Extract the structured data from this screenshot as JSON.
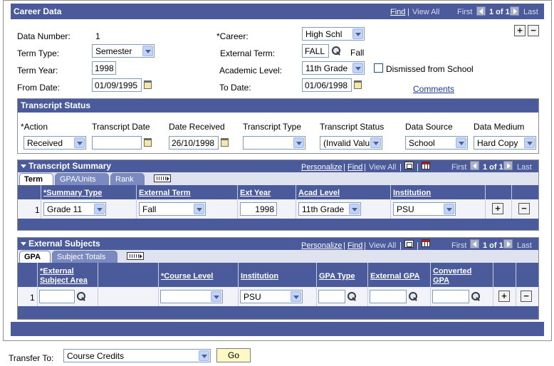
{
  "career_data": {
    "title": "Career Data",
    "nav": {
      "find": "Find",
      "sep": "|",
      "view_all": "View All",
      "first": "First",
      "count": "1 of 1",
      "last": "Last"
    },
    "fields": {
      "data_number_label": "Data Number:",
      "data_number_value": "1",
      "career_label": "*Career:",
      "career_value": "High Schl",
      "term_type_label": "Term Type:",
      "term_type_value": "Semester",
      "external_term_label": "External Term:",
      "external_term_value": "FALL",
      "external_term_desc": "Fall",
      "term_year_label": "Term Year:",
      "term_year_value": "1998",
      "academic_level_label": "Academic Level:",
      "academic_level_value": "11th Grade",
      "dismissed_label": "Dismissed from School",
      "from_date_label": "From Date:",
      "from_date_value": "01/09/1995",
      "to_date_label": "To Date:",
      "to_date_value": "01/06/1998",
      "comments_link": "Comments"
    },
    "add_btn": "+",
    "remove_btn": "−"
  },
  "transcript_status": {
    "title": "Transcript Status",
    "headers": [
      "*Action",
      "Transcript Date",
      "Date Received",
      "Transcript Type",
      "Transcript Status",
      "Data Source",
      "Data Medium"
    ],
    "values": {
      "action": "Received",
      "transcript_date": "",
      "date_received": "26/10/1998",
      "transcript_type": "",
      "transcript_status": "(Invalid Valu",
      "data_source": "School",
      "data_medium": "Hard Copy"
    }
  },
  "transcript_summary": {
    "title": "Transcript Summary",
    "nav": {
      "personalize": "Personalize",
      "find": "Find",
      "view_all": "View All",
      "first": "First",
      "count": "1 of 1",
      "last": "Last"
    },
    "tabs": [
      "Term",
      "GPA/Units",
      "Rank"
    ],
    "columns": [
      "*Summary Type",
      "External Term",
      "Ext Year",
      "Acad Level",
      "Institution"
    ],
    "row": {
      "num": "1",
      "summary_type": "Grade 11",
      "external_term": "Fall",
      "ext_year": "1998",
      "acad_level": "11th Grade",
      "institution": "PSU"
    }
  },
  "external_subjects": {
    "title": "External Subjects",
    "nav": {
      "personalize": "Personalize",
      "find": "Find",
      "view_all": "View All",
      "first": "First",
      "count": "1 of 1",
      "last": "Last"
    },
    "tabs": [
      "GPA",
      "Subject Totals"
    ],
    "columns": [
      "*External",
      "Subject Area",
      "*Course Level",
      "Institution",
      "GPA Type",
      "External GPA",
      "Converted",
      "GPA"
    ],
    "row": {
      "num": "1",
      "subject_area": "",
      "course_level": "",
      "institution": "PSU",
      "gpa_type": "",
      "external_gpa": "",
      "converted_gpa": ""
    }
  },
  "footer": {
    "transfer_label": "Transfer To:",
    "transfer_value": "Course Credits",
    "go_label": "Go"
  }
}
